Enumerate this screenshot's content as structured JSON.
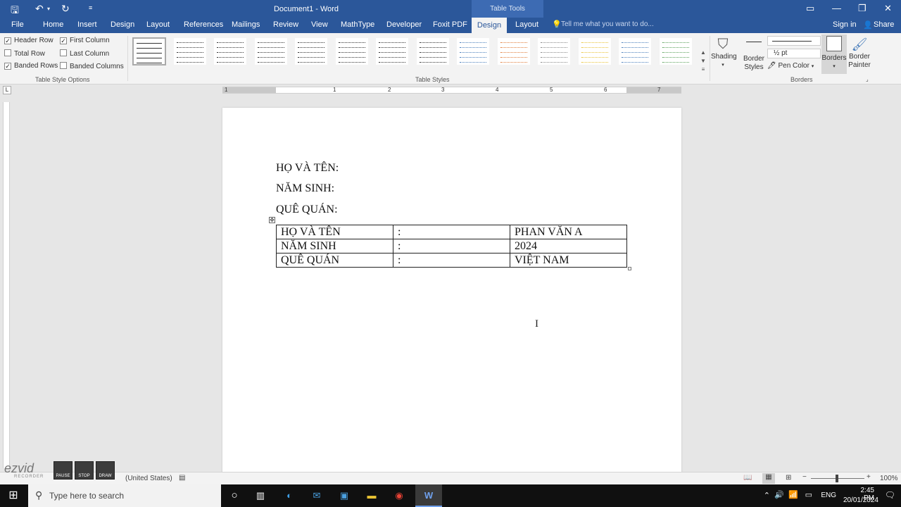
{
  "title_bar": {
    "document_title": "Document1 - Word",
    "contextual_tab_group": "Table Tools",
    "quick_access": {
      "save_icon": "save-icon",
      "undo_icon": "undo-icon",
      "redo_icon": "redo-icon",
      "customize_icon": "customize-icon"
    },
    "window_buttons": {
      "ribbon_display": "▭",
      "minimize": "—",
      "restore": "❐",
      "close": "✕"
    }
  },
  "tabs": {
    "file": "File",
    "home": "Home",
    "insert": "Insert",
    "design": "Design",
    "layout": "Layout",
    "references": "References",
    "mailings": "Mailings",
    "review": "Review",
    "view": "View",
    "mathtype": "MathType",
    "developer": "Developer",
    "foxit": "Foxit PDF",
    "table_design": "Design",
    "table_layout": "Layout",
    "tell_me": "Tell me what you want to do...",
    "sign_in": "Sign in",
    "share": "Share"
  },
  "ribbon": {
    "table_style_options": {
      "header_row": {
        "label": "Header Row",
        "checked": true
      },
      "first_column": {
        "label": "First Column",
        "checked": true
      },
      "total_row": {
        "label": "Total Row",
        "checked": false
      },
      "last_column": {
        "label": "Last Column",
        "checked": false
      },
      "banded_rows": {
        "label": "Banded Rows",
        "checked": true
      },
      "banded_columns": {
        "label": "Banded Columns",
        "checked": false
      },
      "group_label": "Table Style Options"
    },
    "table_styles": {
      "group_label": "Table Styles",
      "count": 14,
      "accent_colors": [
        "#333333",
        "#333333",
        "#333333",
        "#333333",
        "#333333",
        "#333333",
        "#333333",
        "#333333",
        "#4a7ebb",
        "#e07b39",
        "#888888",
        "#e8c233",
        "#4a7ebb",
        "#5aa05a"
      ]
    },
    "shading": {
      "label": "Shading"
    },
    "border_styles": {
      "label_line1": "Border",
      "label_line2": "Styles"
    },
    "pen_weight": "½ pt",
    "pen_color": "Pen Color",
    "borders": {
      "label": "Borders"
    },
    "border_painter": {
      "label_line1": "Border",
      "label_line2": "Painter"
    },
    "borders_group_label": "Borders"
  },
  "ruler": {
    "numbers": [
      "1",
      "1",
      "2",
      "3",
      "4",
      "5",
      "6",
      "7"
    ],
    "corner": "L"
  },
  "document": {
    "lines": [
      "HỌ VÀ TÊN:",
      "NĂM SINH:",
      "QUÊ QUÁN:"
    ],
    "table": [
      [
        "HỌ VÀ TÊN",
        ":",
        "PHAN VĂN A"
      ],
      [
        "NĂM SINH",
        ":",
        "2024"
      ],
      [
        "QUÊ QUÁN",
        ":",
        "VIỆT NAM"
      ]
    ]
  },
  "status_bar": {
    "language": "(United States)",
    "zoom": "100%"
  },
  "recorder": {
    "brand": "ezvid",
    "sub": "RECORDER",
    "pause": "PAUSE",
    "stop": "STOP",
    "draw": "DRAW"
  },
  "taskbar": {
    "search_placeholder": "Type here to search",
    "language": "ENG",
    "time": "2:45 PM",
    "date": "20/01/2024"
  }
}
